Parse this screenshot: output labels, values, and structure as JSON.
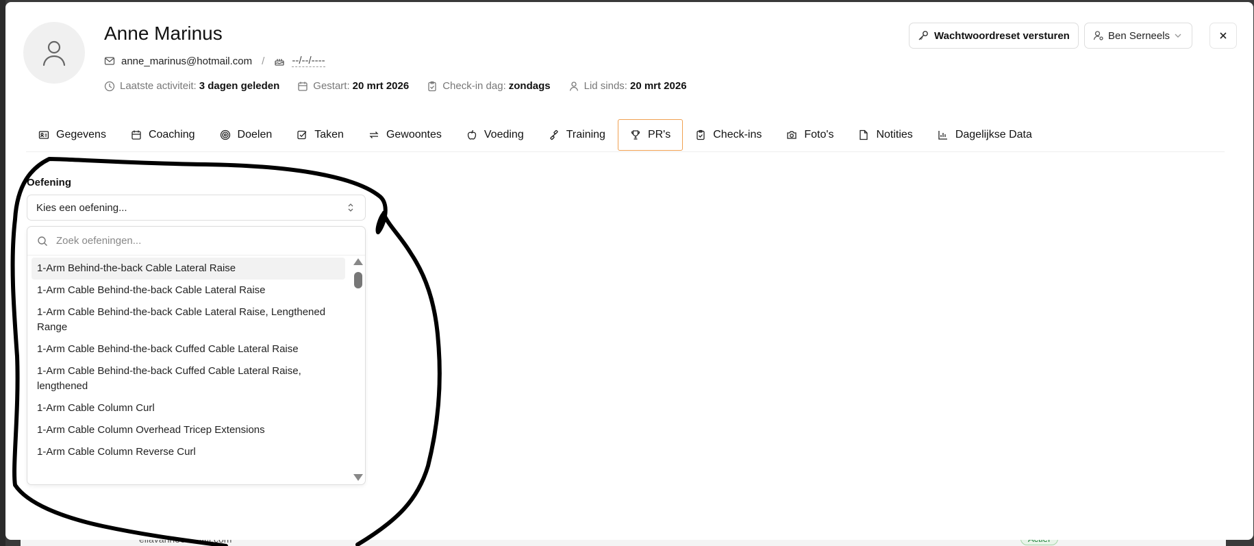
{
  "user": {
    "name": "Anne Marinus",
    "email": "anne_marinus@hotmail.com",
    "separator": "/",
    "birthdate": "--/--/----"
  },
  "meta": {
    "last_activity_label": "Laatste activiteit:",
    "last_activity_value": "3 dagen geleden",
    "started_label": "Gestart:",
    "started_value": "20 mrt 2026",
    "checkin_label": "Check-in dag:",
    "checkin_value": "zondags",
    "member_label": "Lid sinds:",
    "member_value": "20 mrt 2026"
  },
  "header_actions": {
    "reset_label": "Wachtwoordreset versturen",
    "coach_label": "Ben Serneels"
  },
  "tabs": [
    {
      "label": "Gegevens",
      "icon": "id-card-icon"
    },
    {
      "label": "Coaching",
      "icon": "calendar-icon"
    },
    {
      "label": "Doelen",
      "icon": "target-icon"
    },
    {
      "label": "Taken",
      "icon": "checkbox-icon"
    },
    {
      "label": "Gewoontes",
      "icon": "repeat-icon"
    },
    {
      "label": "Voeding",
      "icon": "apple-icon"
    },
    {
      "label": "Training",
      "icon": "dumbbell-icon"
    },
    {
      "label": "PR's",
      "icon": "trophy-icon",
      "active": true
    },
    {
      "label": "Check-ins",
      "icon": "clipboard-check-icon"
    },
    {
      "label": "Foto's",
      "icon": "camera-icon"
    },
    {
      "label": "Notities",
      "icon": "note-icon"
    },
    {
      "label": "Dagelijkse Data",
      "icon": "bar-chart-icon"
    }
  ],
  "exercise": {
    "label": "Oefening",
    "select_placeholder": "Kies een oefening...",
    "search_placeholder": "Zoek oefeningen...",
    "options": [
      "1-Arm Behind-the-back Cable Lateral Raise",
      "1-Arm Cable Behind-the-back Cable Lateral Raise",
      "1-Arm Cable Behind-the-back Cable Lateral Raise, Lengthened Range",
      "1-Arm Cable Behind-the-back Cuffed Cable Lateral Raise",
      "1-Arm Cable Behind-the-back Cuffed Cable Lateral Raise, lengthened",
      "1-Arm Cable Column Curl",
      "1-Arm Cable Column Overhead Tricep Extensions",
      "1-Arm Cable Column Reverse Curl"
    ]
  },
  "background": {
    "email_fragment": "ellavanhoe...mail.com",
    "status_badge": "Actief"
  },
  "colors": {
    "active_tab_border": "#f0a050",
    "annotation_stroke": "#000000"
  }
}
